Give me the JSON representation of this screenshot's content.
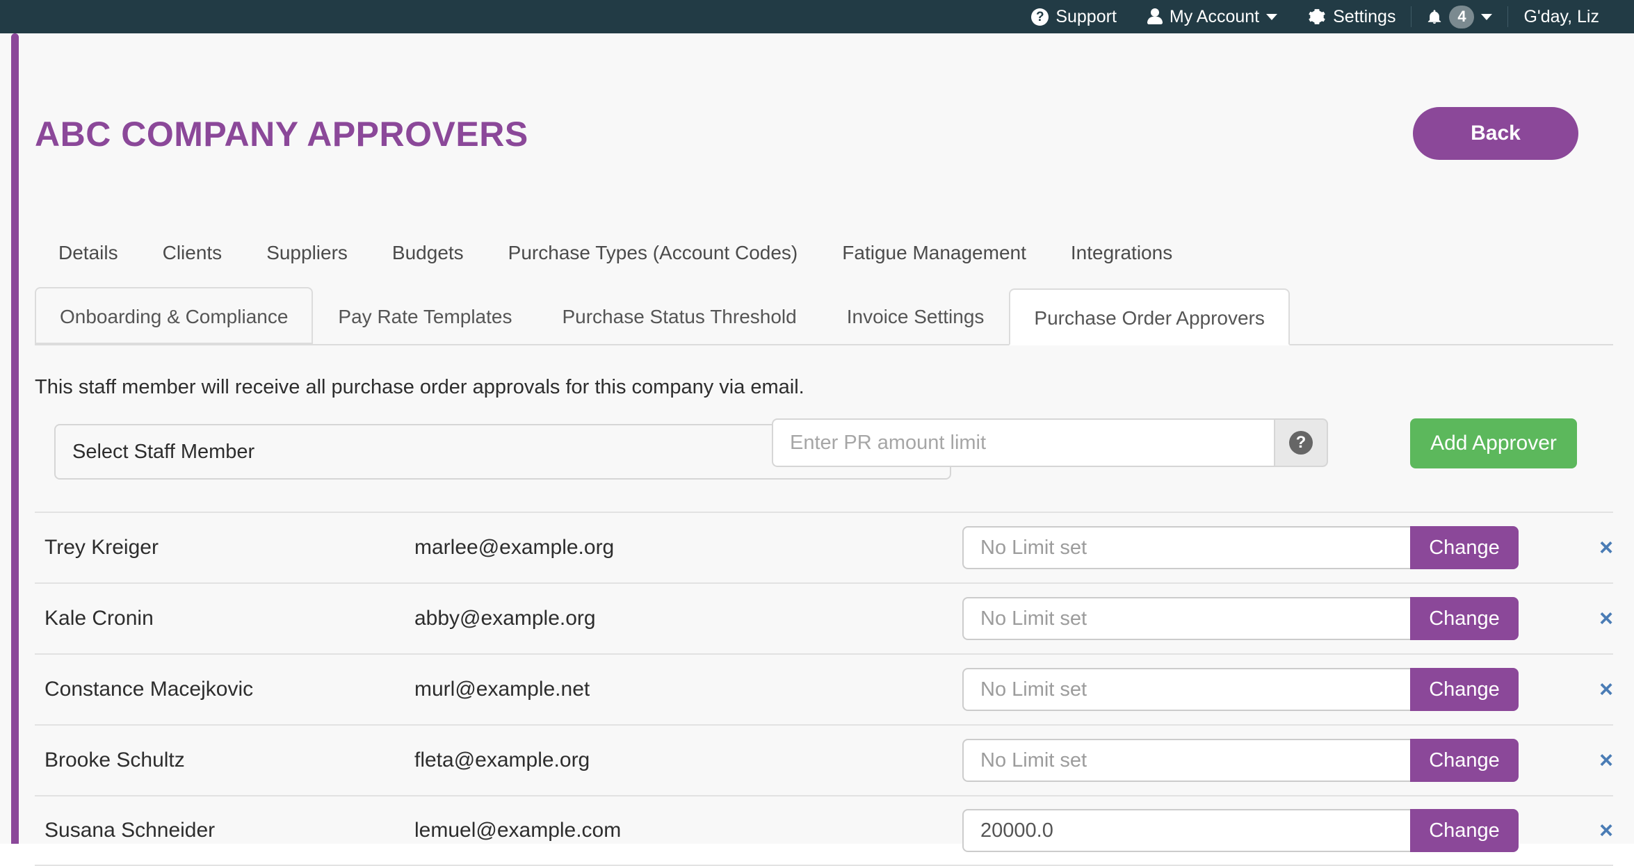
{
  "topbar": {
    "support_label": "Support",
    "my_account_label": "My Account",
    "settings_label": "Settings",
    "notification_count": "4",
    "greeting": "G'day, Liz",
    "background_color": "#223b45"
  },
  "header": {
    "title": "ABC COMPANY APPROVERS",
    "back_label": "Back",
    "accent_color": "#8b4899"
  },
  "primary_tabs": [
    {
      "label": "Details"
    },
    {
      "label": "Clients"
    },
    {
      "label": "Suppliers"
    },
    {
      "label": "Budgets"
    },
    {
      "label": "Purchase Types (Account Codes)"
    },
    {
      "label": "Fatigue Management"
    },
    {
      "label": "Integrations"
    }
  ],
  "secondary_tabs": [
    {
      "label": "Onboarding & Compliance",
      "state": "outlined"
    },
    {
      "label": "Pay Rate Templates",
      "state": "normal"
    },
    {
      "label": "Purchase Status Threshold",
      "state": "normal"
    },
    {
      "label": "Invoice Settings",
      "state": "normal"
    },
    {
      "label": "Purchase Order Approvers",
      "state": "active"
    }
  ],
  "main": {
    "description": "This staff member will receive all purchase order approvals for this company via email.",
    "select_staff_label": "Select Staff Member",
    "pr_limit_placeholder": "Enter PR amount limit",
    "pr_limit_value": "",
    "help_glyph": "?",
    "add_approver_label": "Add Approver",
    "add_approver_color": "#5cb85c",
    "delete_glyph": "×"
  },
  "approvers": [
    {
      "name": "Trey Kreiger",
      "email": "marlee@example.org",
      "limit_value": "",
      "limit_placeholder": "No Limit set",
      "change_label": "Change"
    },
    {
      "name": "Kale Cronin",
      "email": "abby@example.org",
      "limit_value": "",
      "limit_placeholder": "No Limit set",
      "change_label": "Change"
    },
    {
      "name": "Constance Macejkovic",
      "email": "murl@example.net",
      "limit_value": "",
      "limit_placeholder": "No Limit set",
      "change_label": "Change"
    },
    {
      "name": "Brooke Schultz",
      "email": "fleta@example.org",
      "limit_value": "",
      "limit_placeholder": "No Limit set",
      "change_label": "Change"
    },
    {
      "name": "Susana Schneider",
      "email": "lemuel@example.com",
      "limit_value": "20000.0",
      "limit_placeholder": "No Limit set",
      "change_label": "Change"
    }
  ]
}
